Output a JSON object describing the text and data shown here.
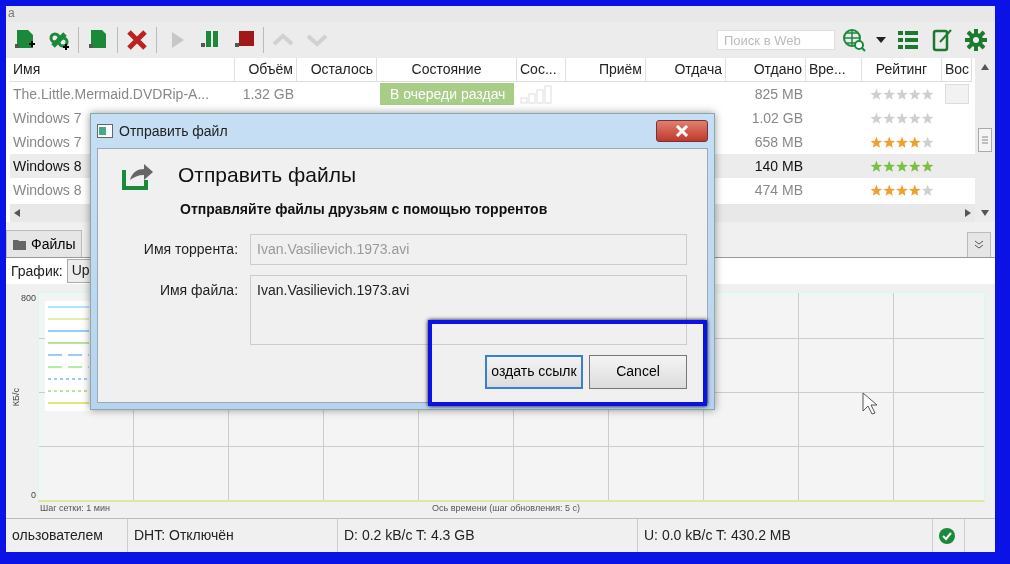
{
  "window": {
    "title": "a"
  },
  "toolbar": {
    "buttons": [
      {
        "kind": "add-file",
        "disabled": false
      },
      {
        "kind": "add-link",
        "disabled": false
      },
      {
        "kind": "create",
        "disabled": false
      },
      {
        "kind": "delete",
        "disabled": false
      },
      {
        "kind": "start",
        "disabled": true
      },
      {
        "kind": "pause",
        "disabled": false
      },
      {
        "kind": "stop",
        "disabled": false
      },
      {
        "kind": "up",
        "disabled": true
      },
      {
        "kind": "down",
        "disabled": true
      }
    ],
    "search": {
      "placeholder": "Поиск в Web"
    }
  },
  "table": {
    "columns": [
      "Имя",
      "Объём",
      "Осталось",
      "Состояние",
      "Сос...",
      "Приём",
      "Отдача",
      "Отдано",
      "Вре...",
      "Рейтинг",
      "Вос"
    ],
    "rows": [
      {
        "name": "The.Little.Mermaid.DVDRip-A...",
        "size": "1.32 GB",
        "state": "В очереди раздач",
        "sent": "825 MB",
        "stars": 0,
        "selected": false
      },
      {
        "name": "Windows 7",
        "sent": "1.02 GB",
        "stars": 0,
        "selected": false
      },
      {
        "name": "Windows 7",
        "sent": "658 MB",
        "stars": 4,
        "color": "#f0a030",
        "selected": false
      },
      {
        "name": "Windows 8",
        "sent": "140 MB",
        "stars": 5,
        "color": "#7cc040",
        "selected": true
      },
      {
        "name": "Windows 8",
        "sent": "474 MB",
        "stars": 4,
        "color": "#f0a030",
        "selected": false
      }
    ]
  },
  "tabs": [
    {
      "label": "Файлы",
      "selected": true
    }
  ],
  "graph": {
    "label": "График:",
    "dropdown_value": "Up",
    "y_max": "800",
    "y_min": "0",
    "y_unit": "КБ/с",
    "grid_step": "Шаг сетки: 1 мин",
    "time_axis": "Ось времени (шаг обновления: 5 с)"
  },
  "status_bar": {
    "sections": [
      "ользователем",
      "DHT: Отключён",
      "D: 0.2 kB/c T: 4.3 GB",
      "U: 0.0 kB/c T: 430.2 MB"
    ]
  },
  "dialog": {
    "title": "Отправить файл",
    "heading": "Отправить файлы",
    "subtitle": "Отправляйте файлы друзьям с помощью торрентов",
    "fields": [
      {
        "label": "Имя торрента:",
        "value": "Ivan.Vasilievich.1973.avi",
        "disabled": true
      },
      {
        "label": "Имя файла:",
        "value": "Ivan.Vasilievich.1973.avi",
        "disabled": false
      }
    ],
    "buttons": [
      {
        "label": "оздать ссылк",
        "default": true
      },
      {
        "label": "Cancel",
        "default": false
      }
    ]
  }
}
